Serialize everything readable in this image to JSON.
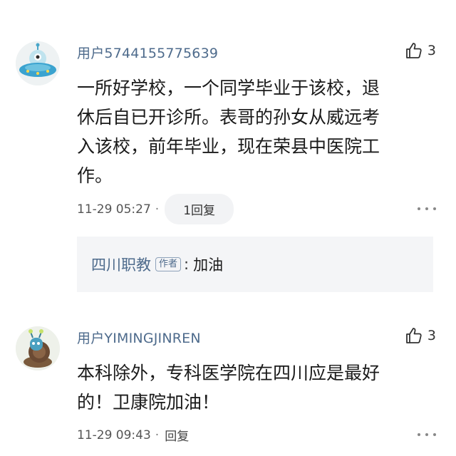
{
  "comments": [
    {
      "username": "用户5744155775639",
      "likes": "3",
      "lines": [
        "一所好学校，一个同学毕业于该校，退",
        "休后自已开诊所。表哥的孙女从威远考",
        "入该校，前年毕业，现在荣县中医院工",
        "作。"
      ],
      "time": "11-29 05:27",
      "separator": "·",
      "reply_label": "1回复",
      "avatar_icon": "alien-ufo-avatar",
      "sub_reply": {
        "user": "四川职教",
        "tag": "作者",
        "colon": ":",
        "text": "加油"
      }
    },
    {
      "username": "用户YIMINGJINREN",
      "likes": "3",
      "lines": [
        "本科除外，专科医学院在四川应是最好",
        "的！卫康院加油！"
      ],
      "time": "11-29 09:43",
      "separator": "·",
      "reply_label": "回复",
      "avatar_icon": "snail-avatar"
    }
  ],
  "colors": {
    "username": "#4e6b8c",
    "sub_box_bg": "#f4f5f7",
    "reply_pill_bg": "#f2f3f5"
  }
}
